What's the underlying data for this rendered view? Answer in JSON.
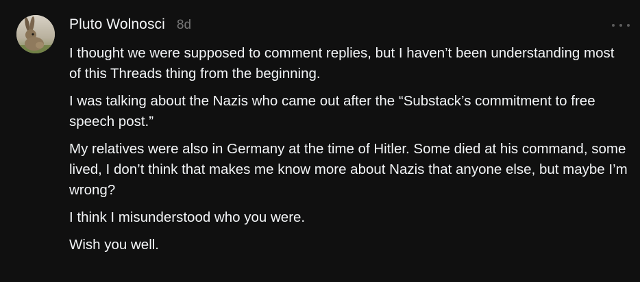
{
  "comment": {
    "author": "Pluto Wolnosci",
    "time_ago": "8d",
    "avatar_icon": "hare-photo-avatar",
    "more_icon": "more-horizontal-icon",
    "paragraphs": [
      "I thought we were supposed to comment replies, but I haven’t been understanding most of this Threads thing from the beginning.",
      "I was talking about the Nazis who came out after the “Substack’s commitment to free speech post.”",
      "My relatives were also in Germany at the time of Hitler. Some died at his command, some lived, I don’t think that makes me know more about Nazis that anyone else, but maybe I’m wrong?",
      "I think I misunderstood who you were.",
      "Wish you well."
    ]
  },
  "colors": {
    "background": "#101010",
    "text": "#f3f5f7",
    "muted": "#777777"
  }
}
